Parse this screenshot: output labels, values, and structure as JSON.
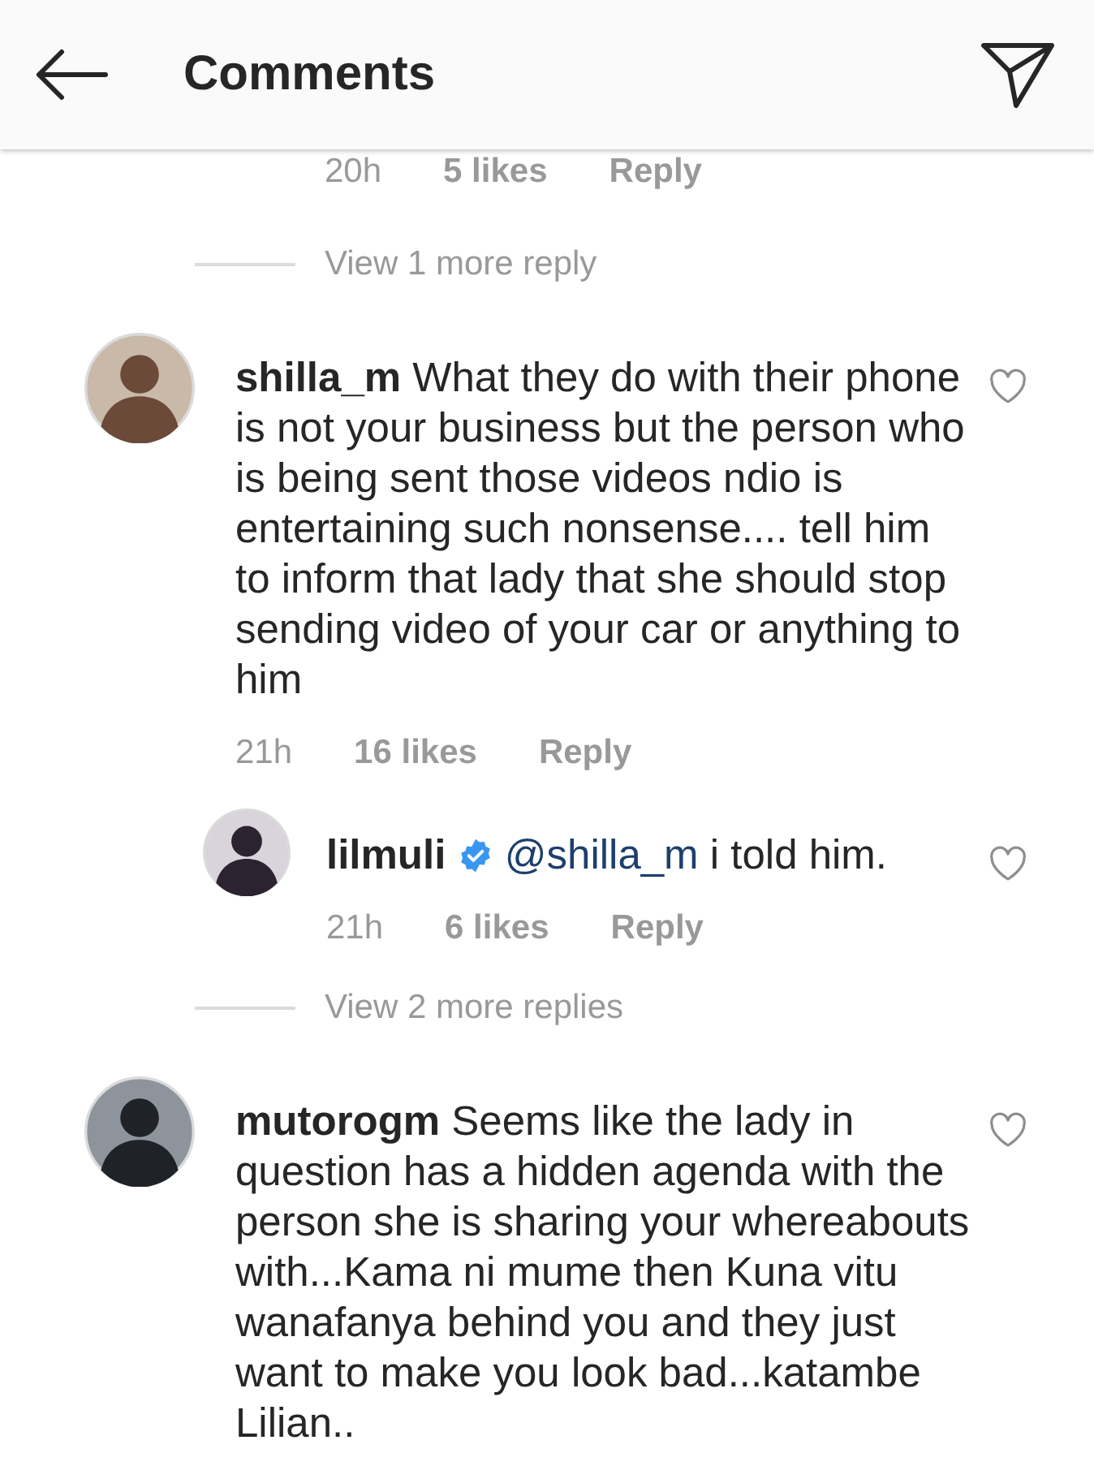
{
  "header": {
    "title": "Comments"
  },
  "items": [
    {
      "kind": "meta",
      "nested": true,
      "time": "20h",
      "likes": "5 likes",
      "reply": "Reply"
    },
    {
      "kind": "more",
      "label": "View 1 more reply"
    },
    {
      "kind": "comment",
      "nested": false,
      "username": "shilla_m",
      "verified": false,
      "text": "What they do with their phone is not your business but the person who is being sent those videos ndio is entertaining such nonsense.... tell him to inform that lady that she should stop sending video of your car or anything to him",
      "liked": false,
      "time": "21h",
      "likes": "16 likes",
      "reply": "Reply"
    },
    {
      "kind": "comment",
      "nested": true,
      "username": "lilmuli",
      "verified": true,
      "mention": "@shilla_m",
      "text": "i told him.",
      "liked": false,
      "time": "21h",
      "likes": "6 likes",
      "reply": "Reply"
    },
    {
      "kind": "more",
      "label": "View 2 more replies"
    },
    {
      "kind": "comment",
      "nested": false,
      "username": "mutorogm",
      "verified": false,
      "text": "Seems like the lady in question has a hidden agenda with the person she is sharing your whereabouts with...Kama ni mume then Kuna vitu wanafanya behind you and they just want to make you look bad...katambe Lilian..",
      "liked": false
    }
  ]
}
